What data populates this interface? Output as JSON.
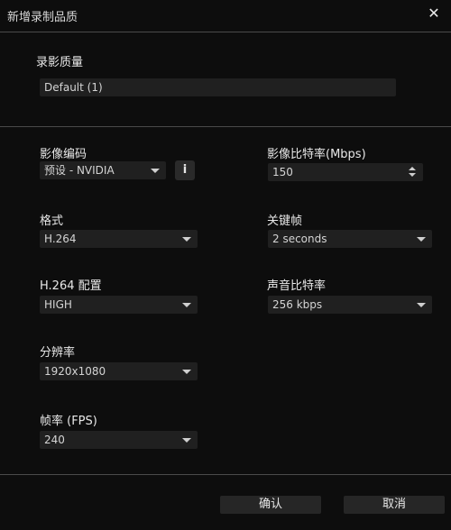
{
  "window": {
    "title": "新增录制品质",
    "close_icon": "close-icon"
  },
  "quality": {
    "label": "录影质量",
    "value": "Default (1)"
  },
  "left": {
    "encoder": {
      "label": "影像编码",
      "value": "预设 - NVIDIA",
      "info_label": "i"
    },
    "format": {
      "label": "格式",
      "value": "H.264"
    },
    "profile": {
      "label": "H.264 配置",
      "value": "HIGH"
    },
    "resolution": {
      "label": "分辨率",
      "value": "1920x1080"
    },
    "fps": {
      "label": "帧率 (FPS)",
      "value": "240"
    }
  },
  "right": {
    "bitrate": {
      "label": "影像比特率(Mbps)",
      "value": "150"
    },
    "keyframe": {
      "label": "关键帧",
      "value": "2 seconds"
    },
    "audio_bitrate": {
      "label": "声音比特率",
      "value": "256 kbps"
    }
  },
  "buttons": {
    "confirm": "确认",
    "cancel": "取消"
  }
}
